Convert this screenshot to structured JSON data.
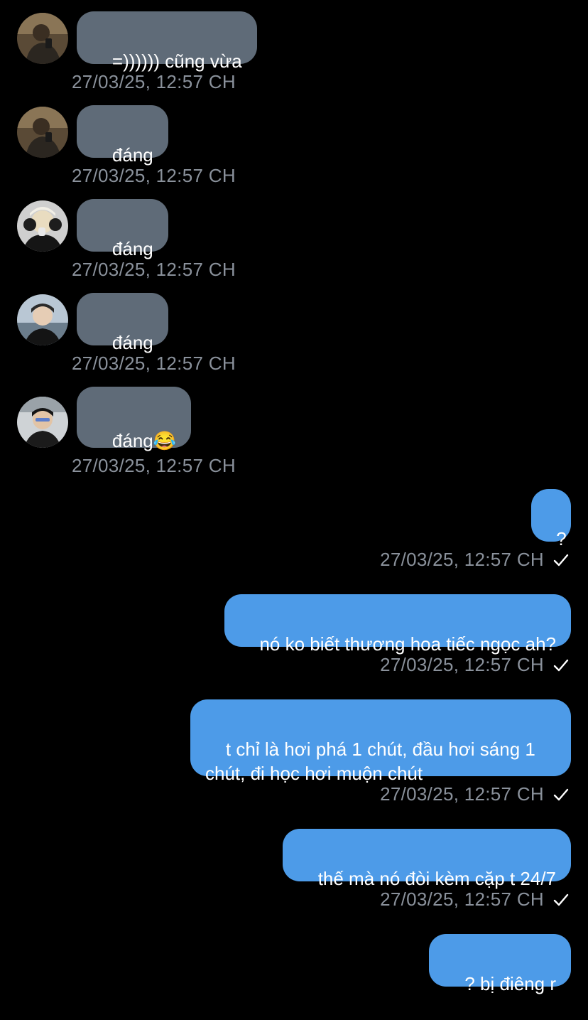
{
  "messages_in": [
    {
      "text": "=)))))) cũng vừa",
      "time": "27/03/25, 12:57 CH",
      "avatar": "avatar-user-a"
    },
    {
      "text": "đáng",
      "time": "27/03/25, 12:57 CH",
      "avatar": "avatar-user-a"
    },
    {
      "text": "đáng",
      "time": "27/03/25, 12:57 CH",
      "avatar": "avatar-user-b"
    },
    {
      "text": "đáng",
      "time": "27/03/25, 12:57 CH",
      "avatar": "avatar-user-c"
    },
    {
      "text": "đáng😂",
      "time": "27/03/25, 12:57 CH",
      "avatar": "avatar-user-d"
    }
  ],
  "messages_out": [
    {
      "text": "?",
      "time": "27/03/25, 12:57 CH"
    },
    {
      "text": "nó ko biết thương hoa tiếc ngọc ah?",
      "time": "27/03/25, 12:57 CH"
    },
    {
      "text": "t chỉ là hơi phá 1 chút, đầu hơi sáng 1\nchút, đi học hơi muộn chút",
      "time": "27/03/25, 12:57 CH"
    },
    {
      "text": "thế mà nó đòi kèm cặp t 24/7",
      "time": "27/03/25, 12:57 CH"
    },
    {
      "text": "? bị điêng r"
    }
  ],
  "colors": {
    "incoming_bubble": "#5f6b78",
    "outgoing_bubble": "#4d9be8",
    "timestamp": "#8a919b",
    "background": "#000000"
  }
}
